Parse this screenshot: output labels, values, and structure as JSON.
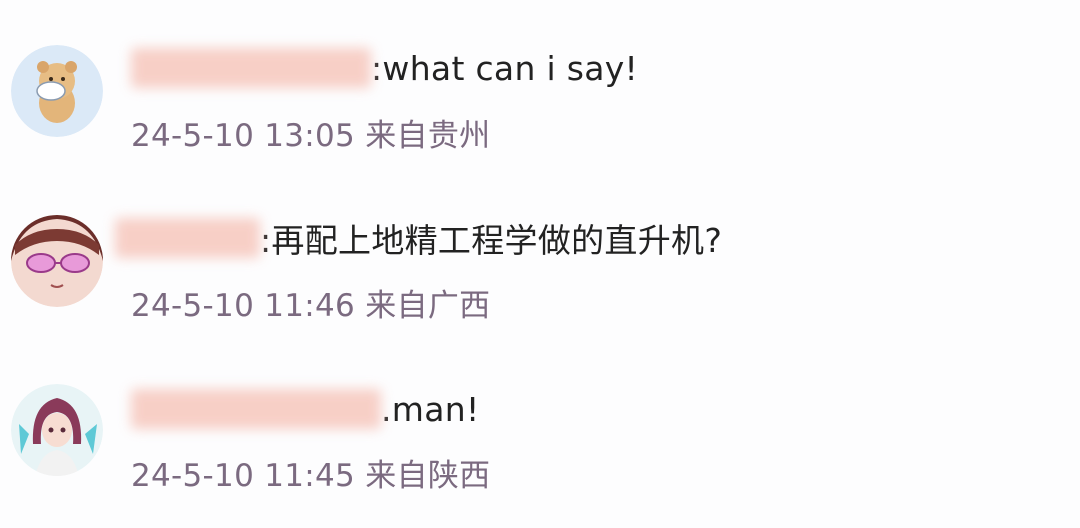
{
  "comments": [
    {
      "avatar": "bear-avatar-icon",
      "text": ":what can i say!",
      "time": "24-5-10 13:05",
      "location": "来自贵州"
    },
    {
      "avatar": "girl-with-glasses-avatar-icon",
      "text": ":再配上地精工程学做的直升机?",
      "time": "24-5-10 11:46",
      "location": "来自广西"
    },
    {
      "avatar": "anime-girl-avatar-icon",
      "text": ".man!",
      "time": "24-5-10 11:45",
      "location": "来自陕西"
    }
  ],
  "colors": {
    "meta_text": "#7b6a80",
    "comment_text": "#222222",
    "redaction": "#f6c7bd"
  }
}
